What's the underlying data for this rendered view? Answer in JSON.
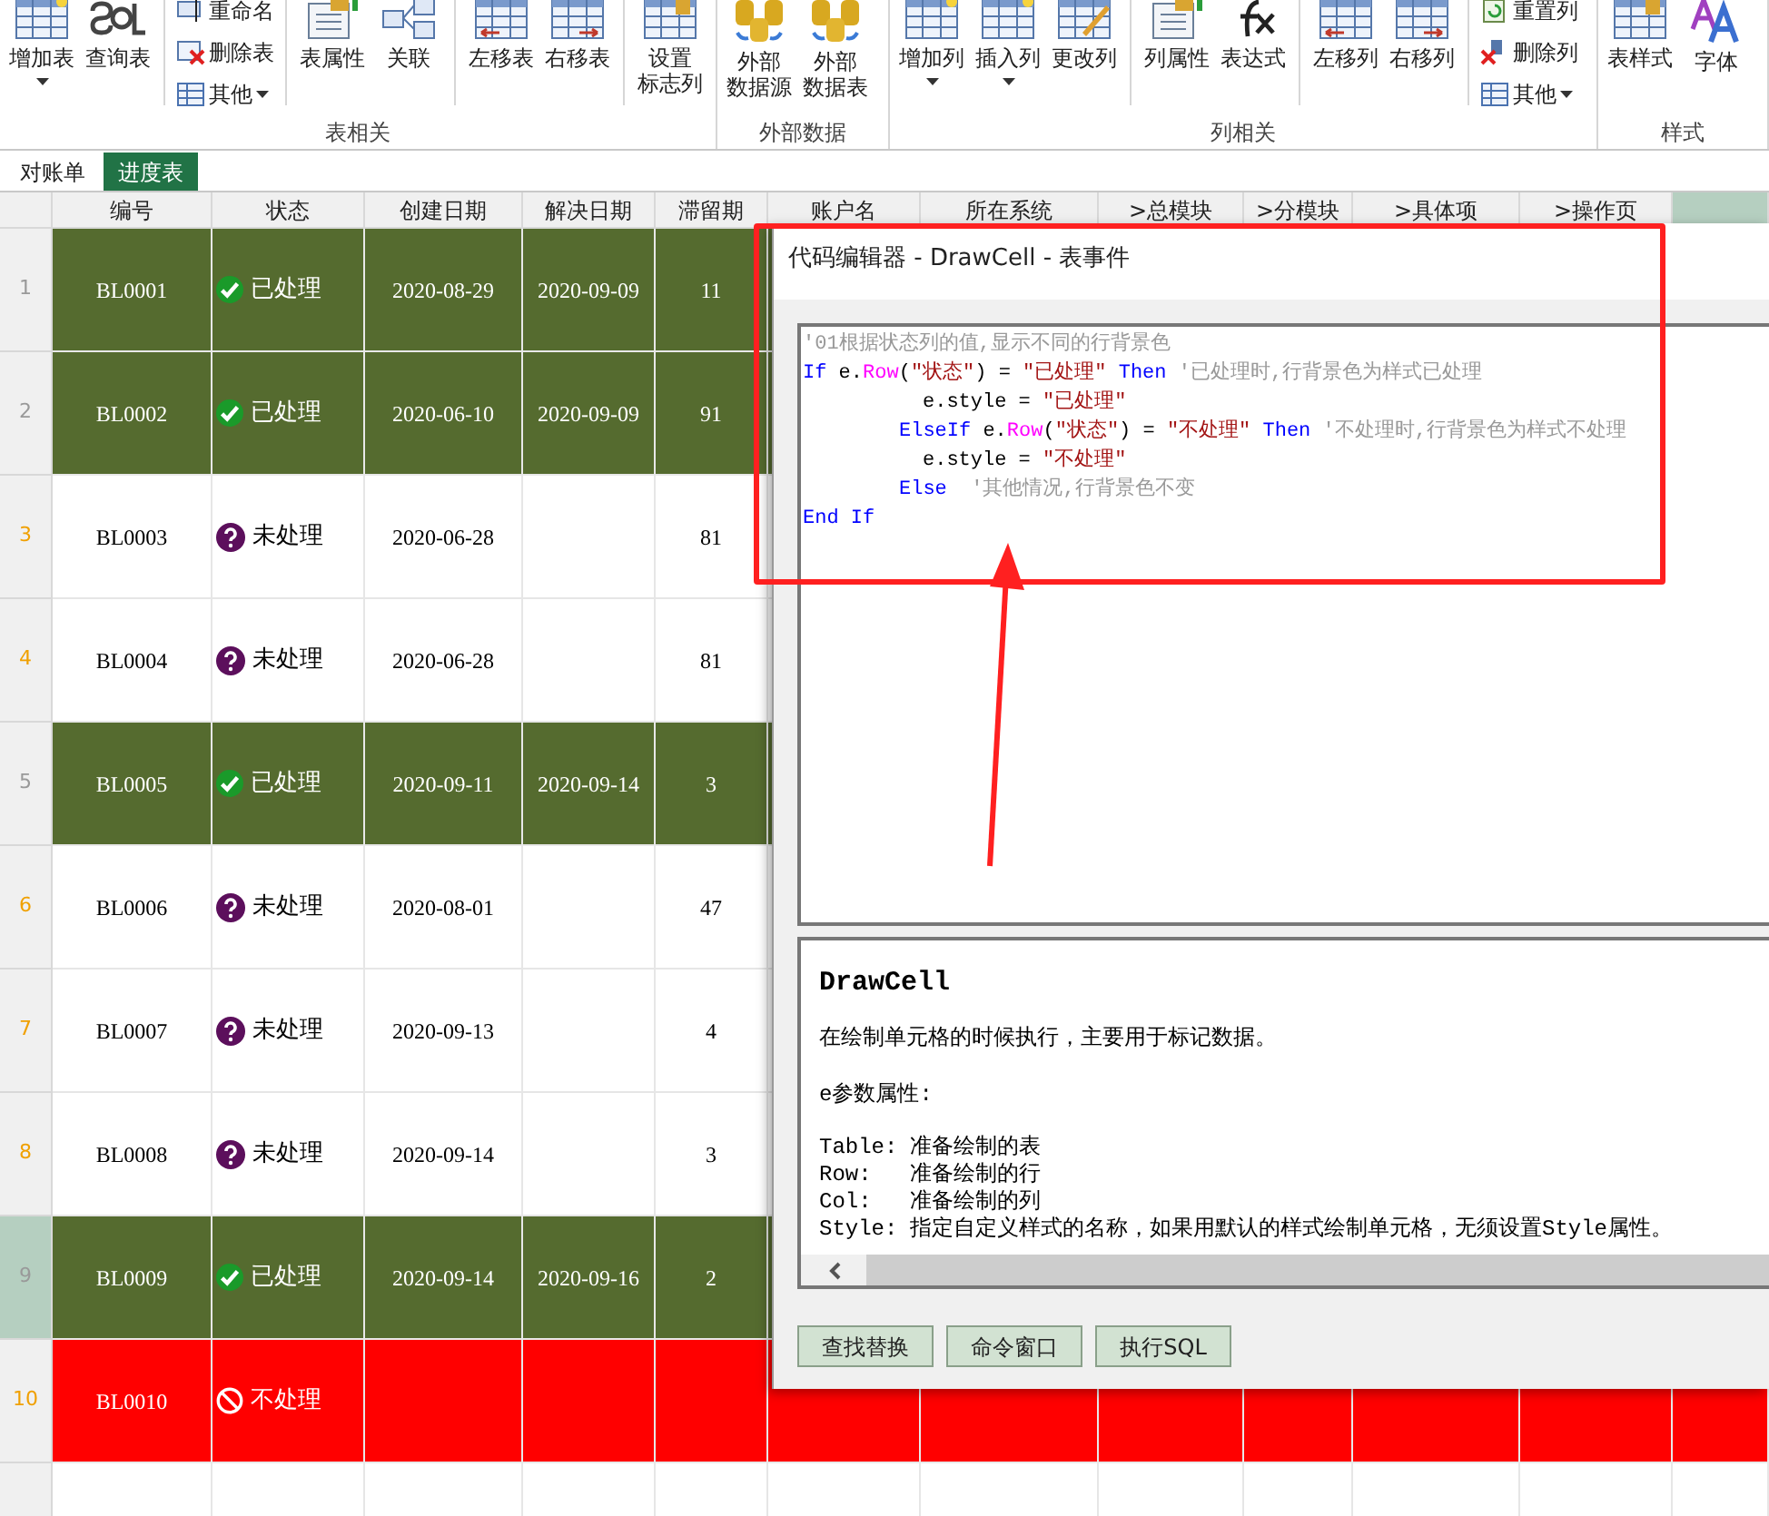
{
  "ribbon": {
    "groups": [
      {
        "label": "表相关",
        "items": [
          {
            "kind": "large",
            "label": "增加表",
            "dropdown": true
          },
          {
            "kind": "large",
            "label": "查询表",
            "dropdown": false
          },
          {
            "kind": "stack",
            "items": [
              {
                "label": "重命名",
                "dropdown": false
              },
              {
                "label": "删除表",
                "dropdown": false
              },
              {
                "label": "其他",
                "dropdown": true
              }
            ]
          },
          {
            "kind": "large",
            "label": "表属性",
            "dropdown": false
          },
          {
            "kind": "large",
            "label": "关联",
            "dropdown": false
          },
          {
            "kind": "large",
            "label": "左移表",
            "dropdown": false
          },
          {
            "kind": "large",
            "label": "右移表",
            "dropdown": false
          },
          {
            "kind": "large",
            "label_lines": [
              "设置",
              "标志列"
            ],
            "dropdown": false
          }
        ]
      },
      {
        "label": "外部数据",
        "items": [
          {
            "kind": "large",
            "label_lines": [
              "外部",
              "数据源"
            ],
            "dropdown": false
          },
          {
            "kind": "large",
            "label_lines": [
              "外部",
              "数据表"
            ],
            "dropdown": false
          }
        ]
      },
      {
        "label": "列相关",
        "items": [
          {
            "kind": "large",
            "label": "增加列",
            "dropdown": true
          },
          {
            "kind": "large",
            "label": "插入列",
            "dropdown": true
          },
          {
            "kind": "large",
            "label": "更改列",
            "dropdown": false
          },
          {
            "kind": "large",
            "label": "列属性",
            "dropdown": false
          },
          {
            "kind": "large",
            "label": "表达式",
            "dropdown": false
          },
          {
            "kind": "large",
            "label": "左移列",
            "dropdown": false
          },
          {
            "kind": "large",
            "label": "右移列",
            "dropdown": false
          },
          {
            "kind": "stack",
            "items": [
              {
                "label": "重置列",
                "dropdown": false
              },
              {
                "label": "删除列",
                "dropdown": false
              },
              {
                "label": "其他",
                "dropdown": true
              }
            ]
          }
        ]
      },
      {
        "label": "样式",
        "items": [
          {
            "kind": "large",
            "label": "表样式",
            "dropdown": false
          },
          {
            "kind": "large",
            "label": "字体",
            "dropdown": false
          }
        ]
      }
    ]
  },
  "sheet_tabs": [
    {
      "label": "对账单",
      "selected": false
    },
    {
      "label": "进度表",
      "selected": true
    }
  ],
  "table": {
    "columns": [
      {
        "label": "编号",
        "selected": false
      },
      {
        "label": "状态",
        "selected": false
      },
      {
        "label": "创建日期",
        "selected": false
      },
      {
        "label": "解决日期",
        "selected": false
      },
      {
        "label": "滞留期",
        "selected": false
      },
      {
        "label": "账户名",
        "selected": false
      },
      {
        "label": "所在系统",
        "selected": false
      },
      {
        "label": ">总模块",
        "selected": false
      },
      {
        "label": ">分模块",
        "selected": false
      },
      {
        "label": ">具体项",
        "selected": false
      },
      {
        "label": ">操作页",
        "selected": false
      },
      {
        "selected": true
      }
    ],
    "rows": [
      {
        "number": "1",
        "id": "BL0001",
        "status": {
          "kind": "done",
          "label": "已处理"
        },
        "created": "2020-08-29",
        "resolved": "2020-09-09",
        "days": "11",
        "selected": false
      },
      {
        "number": "2",
        "id": "BL0002",
        "status": {
          "kind": "done",
          "label": "已处理"
        },
        "created": "2020-06-10",
        "resolved": "2020-09-09",
        "days": "91",
        "selected": false
      },
      {
        "number": "3",
        "id": "BL0003",
        "status": {
          "kind": "pending",
          "label": "未处理"
        },
        "created": "2020-06-28",
        "days": "81",
        "selected": false
      },
      {
        "number": "4",
        "id": "BL0004",
        "status": {
          "kind": "pending",
          "label": "未处理"
        },
        "created": "2020-06-28",
        "days": "81",
        "selected": false
      },
      {
        "number": "5",
        "id": "BL0005",
        "status": {
          "kind": "done",
          "label": "已处理"
        },
        "created": "2020-09-11",
        "resolved": "2020-09-14",
        "days": "3",
        "selected": false
      },
      {
        "number": "6",
        "id": "BL0006",
        "status": {
          "kind": "pending",
          "label": "未处理"
        },
        "created": "2020-08-01",
        "days": "47",
        "selected": false
      },
      {
        "number": "7",
        "id": "BL0007",
        "status": {
          "kind": "pending",
          "label": "未处理"
        },
        "created": "2020-09-13",
        "days": "4",
        "selected": false
      },
      {
        "number": "8",
        "id": "BL0008",
        "status": {
          "kind": "pending",
          "label": "未处理"
        },
        "created": "2020-09-14",
        "days": "3",
        "selected": false
      },
      {
        "number": "9",
        "id": "BL0009",
        "status": {
          "kind": "done",
          "label": "已处理"
        },
        "created": "2020-09-14",
        "resolved": "2020-09-16",
        "days": "2",
        "selected": true
      },
      {
        "number": "10",
        "id": "BL0010",
        "status": {
          "kind": "rejected",
          "label": "不处理"
        },
        "selected": false
      }
    ]
  },
  "editor": {
    "title": "代码编辑器 - DrawCell - 表事件",
    "code": [
      {
        "kind": "top",
        "segments": [
          {
            "kind": "comment",
            "text": "'01根据状态列的值,显示不同的行背景色"
          }
        ]
      },
      {
        "kind": "top",
        "segments": [
          {
            "kind": "keyword",
            "text": "If"
          },
          {
            "kind": "plain",
            "text": " e."
          },
          {
            "kind": "member",
            "text": "Row"
          },
          {
            "kind": "plain",
            "text": "("
          },
          {
            "kind": "string",
            "text": "\"状态\""
          },
          {
            "kind": "plain",
            "text": ") = "
          },
          {
            "kind": "string",
            "text": "\"已处理\""
          },
          {
            "kind": "keyword",
            "text": " Then"
          },
          {
            "kind": "comment",
            "text": " '已处理时,行背景色为样式已处理"
          }
        ]
      },
      {
        "kind": "statement",
        "segments": [
          {
            "kind": "plain",
            "text": "e.style = "
          },
          {
            "kind": "string",
            "text": "\"已处理\""
          }
        ]
      },
      {
        "kind": "branch",
        "segments": [
          {
            "kind": "keyword",
            "text": "ElseIf"
          },
          {
            "kind": "plain",
            "text": " e."
          },
          {
            "kind": "member",
            "text": "Row"
          },
          {
            "kind": "plain",
            "text": "("
          },
          {
            "kind": "string",
            "text": "\"状态\""
          },
          {
            "kind": "plain",
            "text": ") = "
          },
          {
            "kind": "string",
            "text": "\"不处理\""
          },
          {
            "kind": "keyword",
            "text": " Then"
          },
          {
            "kind": "comment",
            "text": " '不处理时,行背景色为样式不处理"
          }
        ]
      },
      {
        "kind": "statement",
        "segments": [
          {
            "kind": "plain",
            "text": "e.style = "
          },
          {
            "kind": "string",
            "text": "\"不处理\""
          }
        ]
      },
      {
        "kind": "branch",
        "segments": [
          {
            "kind": "keyword",
            "text": "Else"
          },
          {
            "kind": "comment",
            "text": "  '其他情况,行背景色不变"
          }
        ]
      },
      {
        "kind": "top",
        "segments": [
          {
            "kind": "keyword",
            "text": "End If"
          }
        ]
      }
    ],
    "help": {
      "title": "DrawCell",
      "description": "在绘制单元格的时候执行，主要用于标记数据。",
      "params_heading": "e参数属性:",
      "params": [
        {
          "name": "Table:",
          "text": "准备绘制的表"
        },
        {
          "name": "Row:",
          "text": "准备绘制的行"
        },
        {
          "name": "Col:",
          "text": "准备绘制的列"
        },
        {
          "name": "Style:",
          "text": "指定自定义样式的名称，如果用默认的样式绘制单元格，无须设置Style属性。"
        }
      ]
    },
    "buttons": [
      "查找替换",
      "命令窗口",
      "执行SQL"
    ]
  }
}
